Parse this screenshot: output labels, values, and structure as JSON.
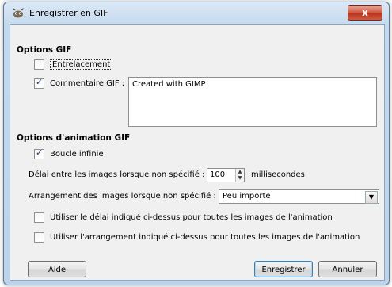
{
  "window": {
    "title": "Enregistrer en GIF",
    "close_label": "x"
  },
  "gif_options": {
    "title": "Options GIF",
    "interlace": {
      "label": "Entrelacement",
      "checked": false
    },
    "comment": {
      "label": "Commentaire GIF :",
      "checked": true,
      "value": "Created with GIMP"
    }
  },
  "animation_options": {
    "title": "Options d'animation GIF",
    "loop": {
      "label": "Boucle infinie",
      "checked": true
    },
    "delay": {
      "label": "Délai entre les images lorsque non spécifié :",
      "value": "100",
      "unit": "millisecondes"
    },
    "disposal": {
      "label": "Arrangement des images lorsque non spécifié :",
      "value": "Peu importe"
    },
    "use_delay": {
      "label": "Utiliser le délai indiqué ci-dessus pour toutes les images de l'animation",
      "checked": false
    },
    "use_disposal": {
      "label": "Utiliser l'arrangement indiqué ci-dessus pour toutes les images de l'animation",
      "checked": false
    }
  },
  "buttons": {
    "help": "Aide",
    "save": "Enregistrer",
    "cancel": "Annuler"
  }
}
